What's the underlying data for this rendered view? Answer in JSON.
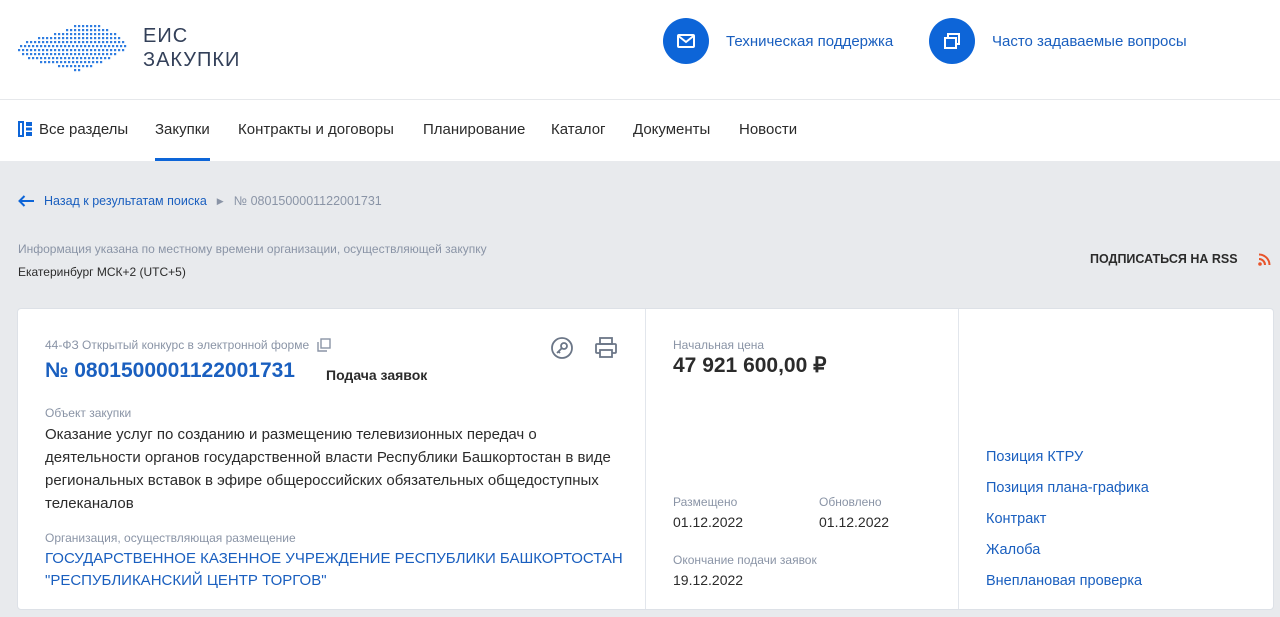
{
  "header": {
    "logo_line1": "ЕИС",
    "logo_line2": "ЗАКУПКИ",
    "support_label": "Техническая поддержка",
    "faq_label": "Часто задаваемые вопросы",
    "accent_color": "#0d65d8"
  },
  "nav": {
    "all_sections": "Все разделы",
    "items": [
      "Закупки",
      "Контракты и договоры",
      "Планирование",
      "Каталог",
      "Документы",
      "Новости"
    ],
    "active": "Закупки"
  },
  "breadcrumb": {
    "back_label": "Назад к результатам поиска",
    "current": "№ 0801500001122001731"
  },
  "timezone": {
    "note": "Информация указана по местному времени организации, осуществляющей закупку",
    "value": "Екатеринбург МСК+2 (UTC+5)"
  },
  "rss_label": "ПОДПИСАТЬСЯ НА RSS",
  "card": {
    "law_type": "44-ФЗ Открытый конкурс в электронной форме",
    "number": "№ 0801500001122001731",
    "stage": "Подача заявок",
    "object_label": "Объект закупки",
    "object_text": "Оказание услуг по созданию и размещению телевизионных передач о деятельности органов государственной власти Республики Башкортостан в виде региональных вставок в эфире общероссийских обязательных общедоступных телеканалов",
    "org_label": "Организация, осуществляющая размещение",
    "org_text": "ГОСУДАРСТВЕННОЕ КАЗЕННОЕ УЧРЕЖДЕНИЕ РЕСПУБЛИКИ БАШКОРТОСТАН \"РЕСПУБЛИКАНСКИЙ ЦЕНТР ТОРГОВ\"",
    "price_label": "Начальная цена",
    "price_value": "47 921 600,00 ₽",
    "posted_label": "Размещено",
    "posted_value": "01.12.2022",
    "updated_label": "Обновлено",
    "updated_value": "01.12.2022",
    "deadline_label": "Окончание подачи заявок",
    "deadline_value": "19.12.2022",
    "links": [
      "Позиция КТРУ",
      "Позиция плана-графика",
      "Контракт",
      "Жалоба",
      "Внеплановая проверка"
    ]
  }
}
